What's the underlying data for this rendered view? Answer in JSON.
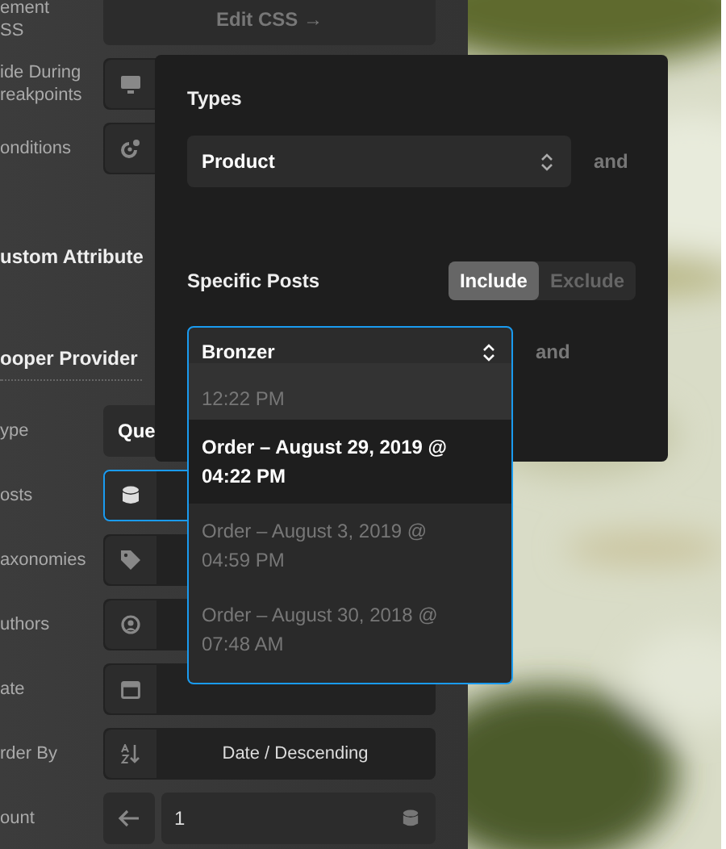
{
  "settings": {
    "rows": [
      {
        "label_lines": [
          "ement",
          "SS"
        ],
        "kind": "button",
        "value": "Edit CSS →"
      },
      {
        "label_lines": [
          "ide During",
          "reakpoints"
        ],
        "kind": "monitor"
      },
      {
        "label_lines": [
          "onditions"
        ],
        "kind": "conditions"
      }
    ],
    "headings": [
      "ustom Attribute",
      "ooper Provider"
    ],
    "provider_rows": [
      {
        "label": "ype",
        "kind": "select",
        "value": "Que"
      },
      {
        "label": "osts",
        "kind": "database",
        "focused": true
      },
      {
        "label": "axonomies",
        "kind": "tag",
        "focused": false
      },
      {
        "label": "uthors",
        "kind": "user",
        "focused": false
      },
      {
        "label": "ate",
        "kind": "calendar",
        "focused": false
      },
      {
        "label": "rder By",
        "kind": "sort",
        "value": "Date / Descending"
      },
      {
        "label": "ount",
        "kind": "count",
        "value": "1"
      }
    ]
  },
  "popover": {
    "types_label": "Types",
    "types_value": "Product",
    "types_and": "and",
    "posts_label": "Specific Posts",
    "toggle": [
      {
        "label": "Include",
        "selected": true
      },
      {
        "label": "Exclude",
        "selected": false
      }
    ],
    "posts_value": "Bronzer",
    "posts_and": "and",
    "options": [
      {
        "lines": [
          "12:22 PM"
        ],
        "selected": false
      },
      {
        "lines": [
          "Order – August 29, 2019 @",
          "04:22 PM"
        ],
        "selected": true
      },
      {
        "lines": [
          "Order – August 3, 2019 @",
          "04:59 PM"
        ],
        "selected": false
      },
      {
        "lines": [
          "Order – August 30, 2018 @",
          "07:48 AM"
        ],
        "selected": false
      }
    ]
  }
}
